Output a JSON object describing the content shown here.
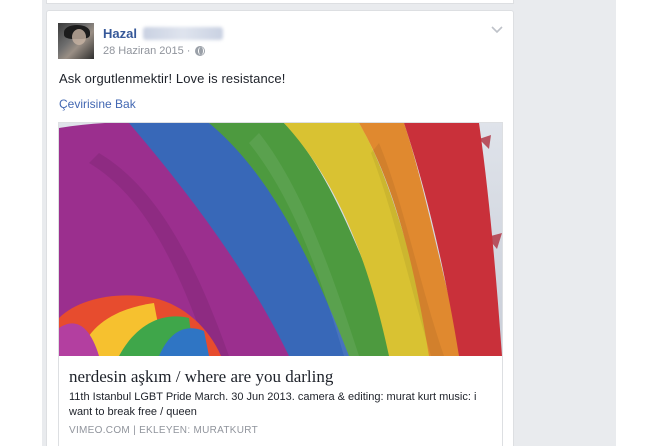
{
  "post": {
    "author": "Hazal",
    "date": "28 Haziran 2015",
    "separator": "·",
    "icons": {
      "privacy": "globe-icon",
      "menu": "chevron-down-icon"
    },
    "text": "Ask orgutlenmektir! Love is resistance!",
    "translate_link": "Çevirisine Bak"
  },
  "link_preview": {
    "image": "rainbow-flag-photo",
    "title": "nerdesin aşkım / where are you darling",
    "description": "11th Istanbul LGBT Pride March. 30 Jun 2013. camera & editing: murat kurt music: i want to break free / queen",
    "source": "VIMEO.COM | EKLEYEN: MURATKURT"
  },
  "colors": {
    "link_blue": "#365899",
    "meta_gray": "#90949c",
    "feed_bg": "#e9ebee"
  }
}
